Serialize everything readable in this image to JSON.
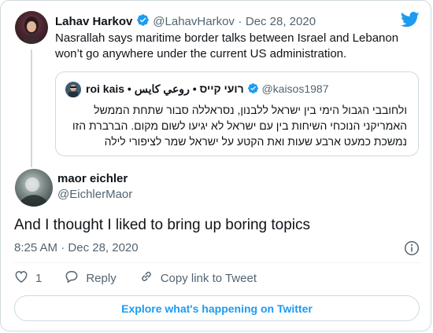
{
  "parent_tweet": {
    "author_name": "Lahav Harkov",
    "handle": "@LahavHarkov",
    "dot": "·",
    "date": "Dec 28, 2020",
    "text": "Nasrallah says maritime border talks between Israel and Lebanon won’t go anywhere under the current US administration."
  },
  "quoted_tweet": {
    "author_name": "roi kais • רועי קייס • روعي كايس",
    "handle": "@kaisos1987",
    "text": "ולחובבי הגבול הימי בין ישראל ללבנון, נסראללה סבור שתחת הממשל האמריקני הנוכחי השיחות בין עם ישראל לא יגיעו לשום מקום. הברברת הזו נמשכת כמעט ארבע שעות ואת הקטע על ישראל שמר לציפורי לילה"
  },
  "main_tweet": {
    "author_name": "maor eichler",
    "handle": "@EichlerMaor",
    "text": "And I thought I liked to bring up boring topics",
    "time": "8:25 AM",
    "dot": "·",
    "date": "Dec 28, 2020"
  },
  "actions": {
    "like_count": "1",
    "reply_label": "Reply",
    "copy_label": "Copy link to Tweet"
  },
  "explore_label": "Explore what's happening on Twitter",
  "colors": {
    "brand": "#1d9bf0",
    "text": "#0f1419",
    "muted": "#536471",
    "border": "#cfd9de"
  }
}
